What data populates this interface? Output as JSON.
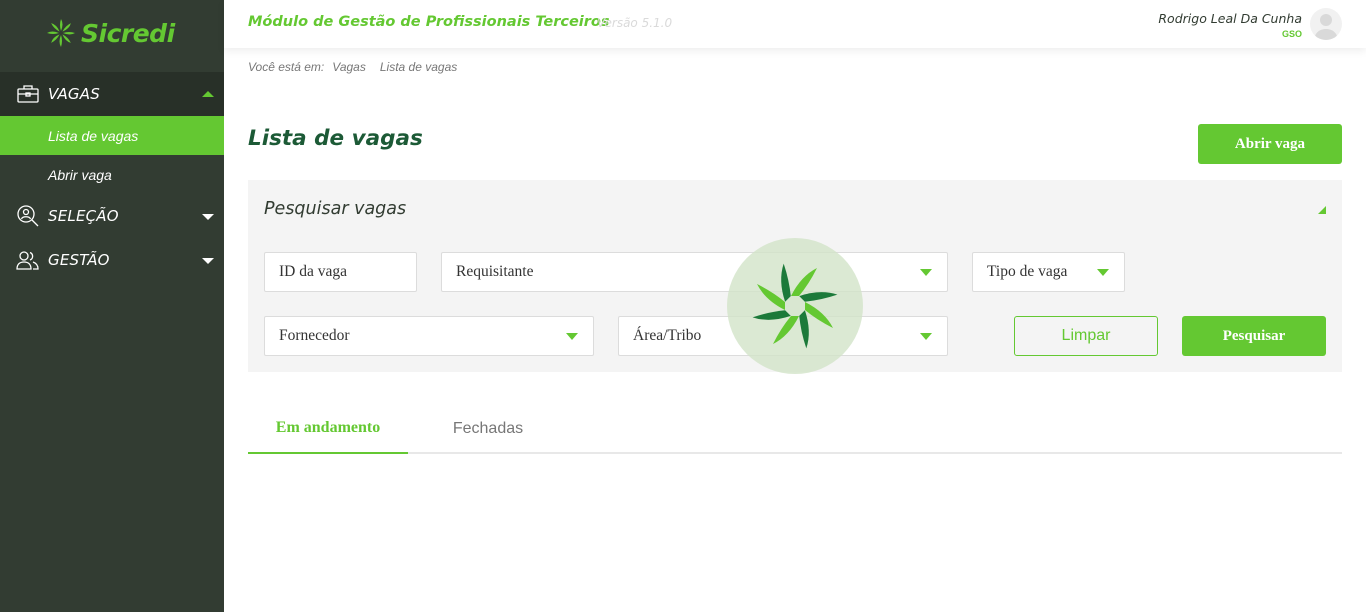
{
  "brand": {
    "name": "Sicredi",
    "accent": "#64c832",
    "dark": "#323c32"
  },
  "sidebar": {
    "sections": [
      {
        "label": "VAGAS",
        "icon": "briefcase-icon",
        "expanded": true,
        "items": [
          {
            "label": "Lista de vagas",
            "active": true
          },
          {
            "label": "Abrir vaga",
            "active": false
          }
        ]
      },
      {
        "label": "SELEÇÃO",
        "icon": "magnifier-person-icon",
        "expanded": false
      },
      {
        "label": "GESTÃO",
        "icon": "users-icon",
        "expanded": false
      }
    ]
  },
  "header": {
    "title": "Módulo de Gestão de Profissionais Terceiros",
    "version": "Versão 5.1.0",
    "user_name": "Rodrigo Leal Da Cunha",
    "user_role": "GSO"
  },
  "breadcrumb": {
    "prefix": "Você está em:",
    "items": [
      "Vagas",
      "Lista de vagas"
    ]
  },
  "main": {
    "title": "Lista de vagas",
    "open_button": "Abrir vaga",
    "search": {
      "title": "Pesquisar vagas",
      "fields": {
        "id": "ID da vaga",
        "requisitante": "Requisitante",
        "tipo": "Tipo de vaga",
        "fornecedor": "Fornecedor",
        "area": "Área/Tribo"
      },
      "clear_button": "Limpar",
      "search_button": "Pesquisar"
    },
    "tabs": [
      {
        "label": "Em andamento",
        "active": true
      },
      {
        "label": "Fechadas",
        "active": false
      }
    ]
  }
}
